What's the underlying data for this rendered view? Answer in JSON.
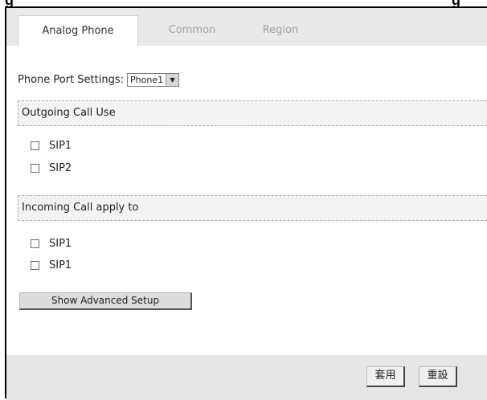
{
  "tabs": [
    {
      "label": "Analog Phone",
      "active": true
    },
    {
      "label": "Common",
      "active": false
    },
    {
      "label": "Region",
      "active": false
    }
  ],
  "port_settings": {
    "label": "Phone Port Settings:",
    "selected": "Phone1"
  },
  "outgoing": {
    "title": "Outgoing Call Use",
    "items": [
      {
        "label": "SIP1",
        "checked": false
      },
      {
        "label": "SIP2",
        "checked": false
      }
    ]
  },
  "incoming": {
    "title": "Incoming Call apply to",
    "items": [
      {
        "label": "SIP1",
        "checked": false
      },
      {
        "label": "SIP1",
        "checked": false
      }
    ]
  },
  "advanced_button": "Show Advanced Setup",
  "footer": {
    "apply": "套用",
    "reset": "重設"
  }
}
